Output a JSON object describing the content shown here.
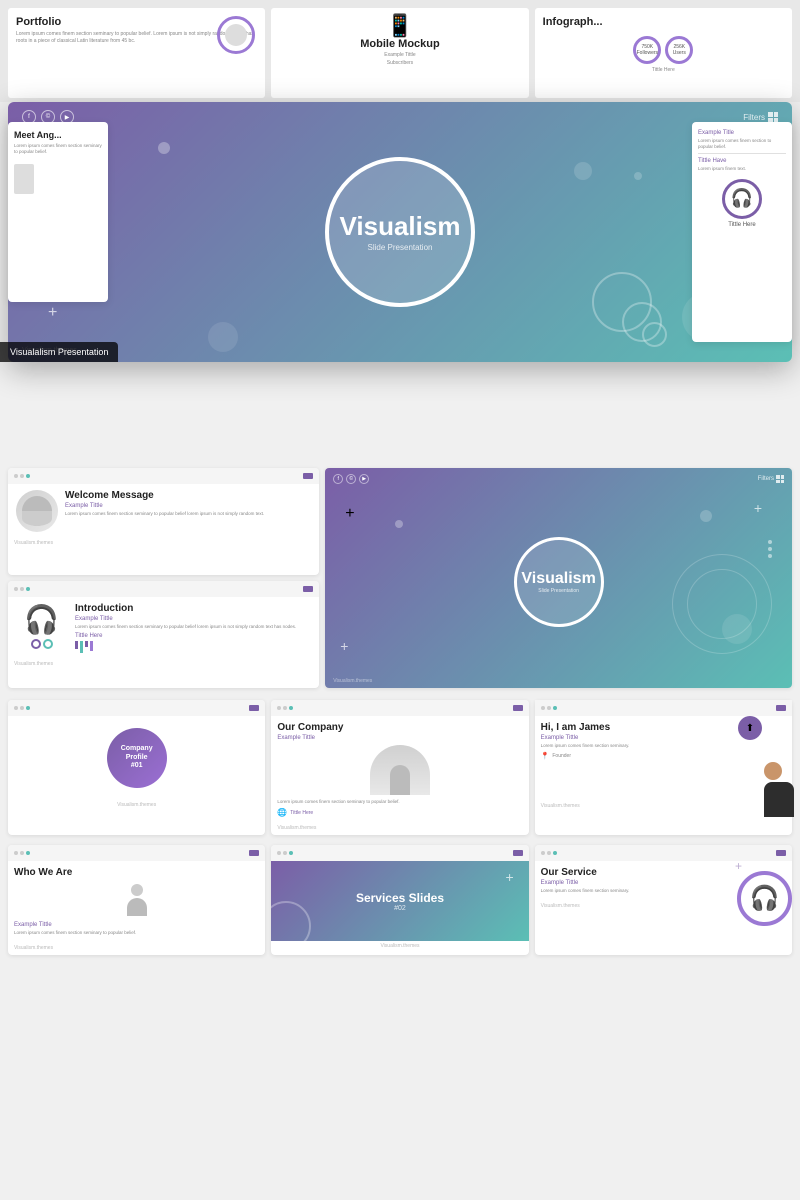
{
  "top_thumbs": {
    "portfolio": {
      "title": "Portfolio",
      "body_text": "Lorem ipsum comes finem section seminary to popular belief. Lorem ipsum is not simply random text. It has roots in a piece of classical Latin literature from 45 bc."
    },
    "mobile_mockup": {
      "title": "Mobile Mockup",
      "example_title": "Example Tittle",
      "subscribers": "Subscribers"
    },
    "infographic": {
      "title": "Infograph...",
      "circle1": "750K Followers",
      "circle2": "256K Users",
      "tittle_here": "Tittle Here"
    }
  },
  "featured": {
    "brand": "Visualism",
    "tagline": "Slide Presentation",
    "website": "Visualism.themes",
    "filters_label": "Filters",
    "social_icons": [
      "f",
      "©",
      "▶"
    ]
  },
  "label_badge": "Visualalism Presentation",
  "side_left": {
    "title": "Meet Ang...",
    "body": "Lorem ipsum comes finem section seminary to popular belief."
  },
  "side_right": {
    "example_title": "Example Title",
    "tittle_have": "Tittle Have",
    "body": "Lorem ipsum comes finem section to popular belief."
  },
  "section2": {
    "welcome": {
      "title": "Welcome Message",
      "example_title": "Example Tittle",
      "body": "Lorem ipsum comes finem section seminary to popular belief lorem ipsum is not simply random text.",
      "footer": "Visualism.themes"
    },
    "main_gradient": {
      "brand": "Visualism",
      "tagline": "Slide Presentation",
      "website": "Visualism.themes",
      "filters_label": "Filters"
    }
  },
  "section3": {
    "introduction": {
      "title": "Introduction",
      "example_title": "Example Tittle",
      "body": "Lorem ipsum comes finem section seminary to popular belief lorem ipsum is not simply random text has nodes.",
      "tittle_here": "Tittle Here",
      "footer": "Visualism.themes"
    },
    "company_profile": {
      "title": "Company Profile",
      "number": "#01",
      "footer": "Visualism.themes"
    },
    "our_company": {
      "title": "Our Company",
      "example_title": "Example Tittle",
      "body": "Lorem ipsum comes finem section seminary to popular belief.",
      "tittle_here": "Tittle Here",
      "footer": "Visualism.themes"
    },
    "hi_james": {
      "title": "Hi, I am James",
      "example_title": "Example Tittle",
      "body": "Lorem ipsum comes finem section seminary.",
      "footer": "Visualism.themes"
    }
  },
  "section4": {
    "who_we_are": {
      "title": "Who We Are",
      "example_title": "Example Tittle",
      "body": "Lorem ipsum comes finem section seminary to popular belief.",
      "footer": "Visualism.themes"
    },
    "services_slides": {
      "title": "Services Slides",
      "number": "#02",
      "footer": "Visualism.themes"
    },
    "our_service": {
      "title": "Our Service",
      "example_title": "Example Tittle",
      "body": "Lorem ipsum comes finem section seminary.",
      "footer": "Visualism.themes"
    }
  },
  "colors": {
    "purple": "#7b5ea7",
    "teal": "#5bbfb5",
    "light_purple": "#9b79d4"
  }
}
